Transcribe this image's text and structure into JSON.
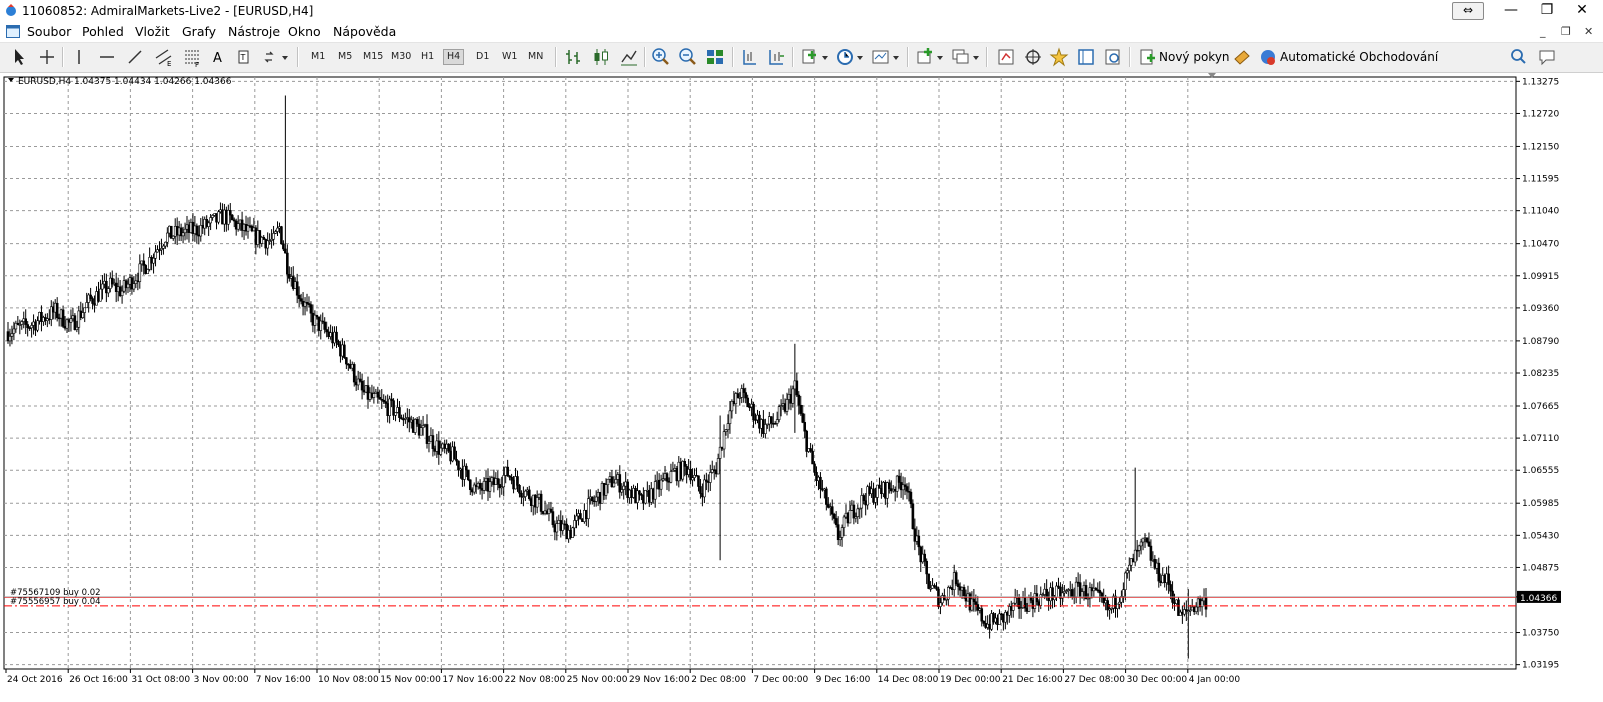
{
  "window": {
    "title": "11060852: AdmiralMarkets-Live2 - [EURUSD,H4]"
  },
  "menu": [
    "Soubor",
    "Pohled",
    "Vložit",
    "Grafy",
    "Nástroje",
    "Okno",
    "Nápověda"
  ],
  "toolbar": {
    "timeframes": [
      "M1",
      "M5",
      "M15",
      "M30",
      "H1",
      "H4",
      "D1",
      "W1",
      "MN"
    ],
    "active_timeframe": "H4",
    "new_order_label": "Nový pokyn",
    "auto_trading_label": "Automatické Obchodování"
  },
  "chart": {
    "info_line": "EURUSD,H4  1.04375 1.04434 1.04266 1.04366",
    "current_price": "1.04366",
    "orders": [
      {
        "label": "#75567109 buy 0.02",
        "price": 1.0436
      },
      {
        "label": "#75556957 buy 0.04",
        "price": 1.0421
      }
    ]
  },
  "chart_data": {
    "type": "candlestick",
    "symbol": "EURUSD",
    "timeframe": "H4",
    "y_tick_labels": [
      "1.13275",
      "1.12720",
      "1.12150",
      "1.11595",
      "1.11040",
      "1.10470",
      "1.09915",
      "1.09360",
      "1.08790",
      "1.08235",
      "1.07665",
      "1.07110",
      "1.06555",
      "1.05985",
      "1.05430",
      "1.04875",
      "1.04366",
      "1.03750",
      "1.03195"
    ],
    "ylim": [
      1.0312,
      1.1335
    ],
    "x_tick_labels": [
      "24 Oct 2016",
      "26 Oct 16:00",
      "31 Oct 08:00",
      "3 Nov 00:00",
      "7 Nov 16:00",
      "10 Nov 08:00",
      "15 Nov 00:00",
      "17 Nov 16:00",
      "22 Nov 08:00",
      "25 Nov 00:00",
      "29 Nov 16:00",
      "2 Dec 08:00",
      "7 Dec 00:00",
      "9 Dec 16:00",
      "14 Dec 08:00",
      "19 Dec 00:00",
      "21 Dec 16:00",
      "27 Dec 08:00",
      "30 Dec 00:00",
      "4 Jan 00:00"
    ],
    "close_path": [
      [
        0,
        1.0895
      ],
      [
        12,
        1.0908
      ],
      [
        24,
        1.093
      ],
      [
        32,
        1.0905
      ],
      [
        42,
        1.095
      ],
      [
        52,
        1.0975
      ],
      [
        58,
        1.0965
      ],
      [
        70,
        1.101
      ],
      [
        80,
        1.106
      ],
      [
        95,
        1.107
      ],
      [
        102,
        1.108
      ],
      [
        110,
        1.1095
      ],
      [
        118,
        1.1075
      ],
      [
        125,
        1.106
      ],
      [
        135,
        1.105
      ],
      [
        138,
        1.1075
      ],
      [
        142,
        1.101
      ],
      [
        148,
        1.096
      ],
      [
        154,
        1.092
      ],
      [
        160,
        1.09
      ],
      [
        166,
        1.088
      ],
      [
        172,
        1.085
      ],
      [
        180,
        1.079
      ],
      [
        190,
        1.077
      ],
      [
        196,
        1.076
      ],
      [
        204,
        1.074
      ],
      [
        212,
        1.072
      ],
      [
        220,
        1.069
      ],
      [
        226,
        1.068
      ],
      [
        232,
        1.065
      ],
      [
        238,
        1.062
      ],
      [
        246,
        1.063
      ],
      [
        254,
        1.065
      ],
      [
        262,
        1.062
      ],
      [
        270,
        1.06
      ],
      [
        278,
        1.056
      ],
      [
        286,
        1.055
      ],
      [
        292,
        1.058
      ],
      [
        300,
        1.061
      ],
      [
        308,
        1.064
      ],
      [
        316,
        1.062
      ],
      [
        322,
        1.06
      ],
      [
        330,
        1.0625
      ],
      [
        338,
        1.065
      ],
      [
        346,
        1.066
      ],
      [
        352,
        1.062
      ],
      [
        360,
        1.066
      ],
      [
        366,
        1.075
      ],
      [
        372,
        1.079
      ],
      [
        378,
        1.076
      ],
      [
        384,
        1.073
      ],
      [
        390,
        1.074
      ],
      [
        396,
        1.077
      ],
      [
        400,
        1.08
      ],
      [
        404,
        1.073
      ],
      [
        410,
        1.065
      ],
      [
        416,
        1.06
      ],
      [
        422,
        1.054
      ],
      [
        428,
        1.058
      ],
      [
        436,
        1.061
      ],
      [
        444,
        1.062
      ],
      [
        452,
        1.063
      ],
      [
        456,
        1.064
      ],
      [
        462,
        1.053
      ],
      [
        468,
        1.046
      ],
      [
        474,
        1.043
      ],
      [
        482,
        1.047
      ],
      [
        490,
        1.042
      ],
      [
        498,
        1.039
      ],
      [
        506,
        1.04
      ],
      [
        512,
        1.042
      ],
      [
        520,
        1.043
      ],
      [
        528,
        1.044
      ],
      [
        536,
        1.044
      ],
      [
        544,
        1.045
      ],
      [
        552,
        1.044
      ],
      [
        560,
        1.041
      ],
      [
        566,
        1.045
      ],
      [
        572,
        1.05
      ],
      [
        578,
        1.053
      ],
      [
        584,
        1.048
      ],
      [
        590,
        1.046
      ],
      [
        596,
        1.04
      ],
      [
        602,
        1.042
      ],
      [
        608,
        1.043
      ]
    ],
    "spikes": [
      {
        "i": 141,
        "high": 1.1303,
        "low": 1.105
      },
      {
        "i": 400,
        "high": 1.0874,
        "low": 1.072
      },
      {
        "i": 573,
        "high": 1.066,
        "low": 1.049
      },
      {
        "i": 600,
        "high": 1.045,
        "low": 1.033
      },
      {
        "i": 362,
        "high": 1.075,
        "low": 1.05
      }
    ],
    "candle_count": 610,
    "grid": true,
    "colors": {
      "up": "#ffffff",
      "down": "#000000",
      "order_line": "#ff0000",
      "price_label_bg": "#000000",
      "price_label_text": "#ffffff",
      "grid": "#9a9a9a"
    }
  }
}
